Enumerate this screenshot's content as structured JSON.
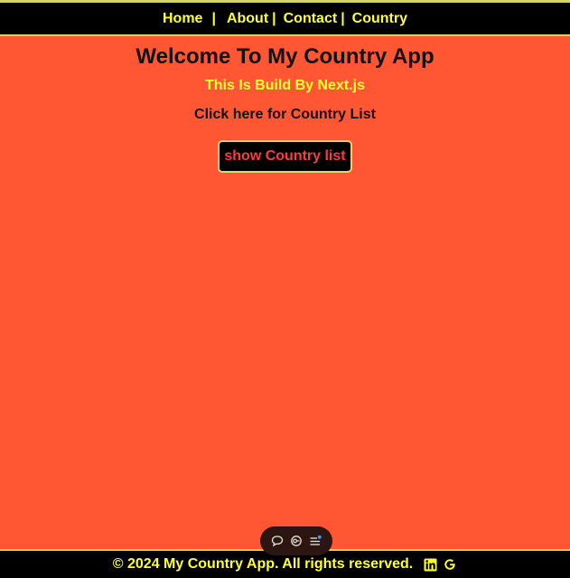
{
  "nav": {
    "items": [
      {
        "label": "Home"
      },
      {
        "label": "About"
      },
      {
        "label": "Contact"
      },
      {
        "label": "Country"
      }
    ],
    "separator": "|"
  },
  "main": {
    "title": "Welcome To My Country App",
    "subtitle": "This Is Build By Next.js",
    "cta_text": "Click here for Country List",
    "button_label": "show Country list"
  },
  "floating_toolbar": {
    "icons": [
      "chat-icon",
      "toggle-icon",
      "menu-notification-icon"
    ]
  },
  "footer": {
    "text": "© 2024 My Country App. All rights reserved.",
    "icons": [
      "linkedin-icon",
      "google-icon"
    ]
  },
  "colors": {
    "background": "#ff5733",
    "bar": "#000000",
    "accent_yellow": "#ffff33",
    "button_text": "#ff3b3b",
    "border": "#d4d46a"
  }
}
